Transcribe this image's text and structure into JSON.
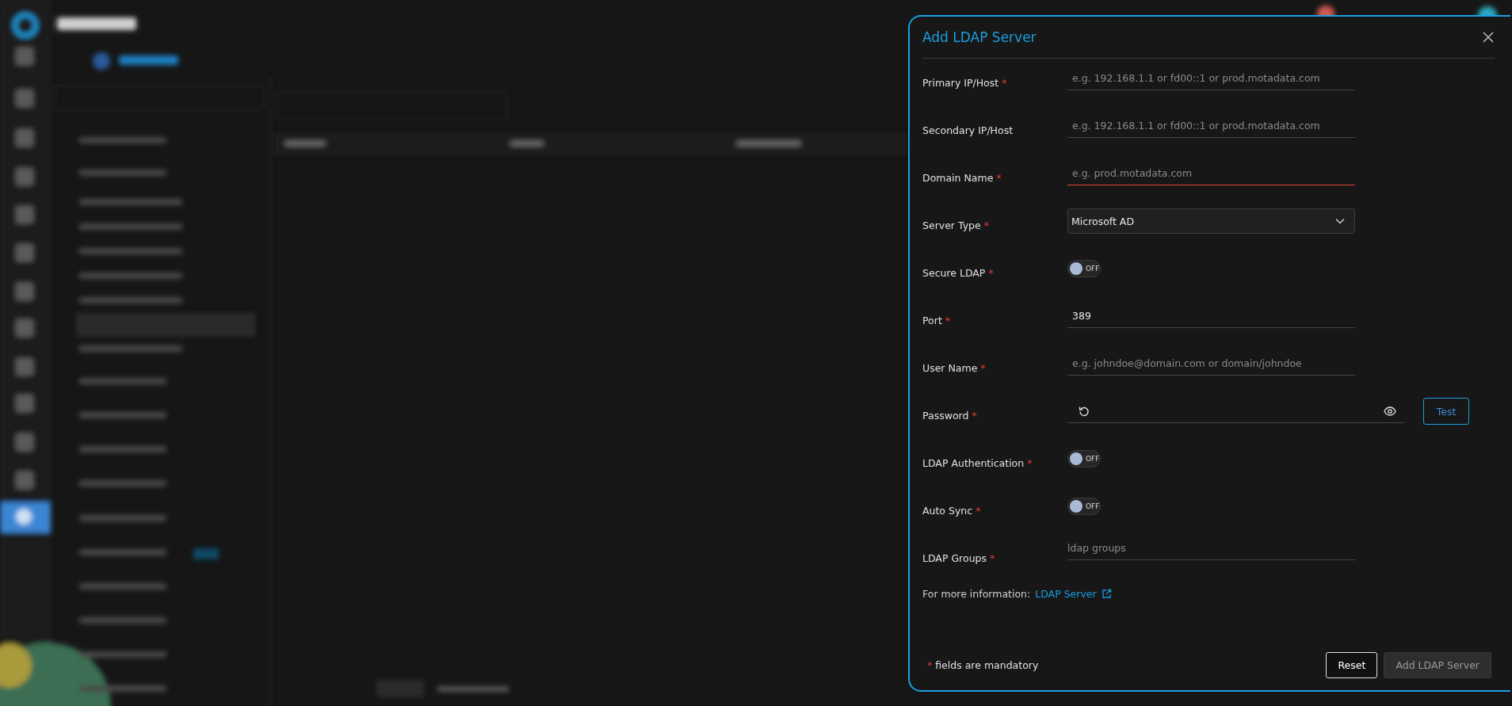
{
  "dialog": {
    "title": "Add LDAP Server",
    "required_mark": "*",
    "fields": [
      {
        "kind": "text",
        "label": "Primary IP/Host",
        "required": true,
        "placeholder": "e.g. 192.168.1.1 or fd00::1 or prod.motadata.com",
        "invalid": false
      },
      {
        "kind": "text",
        "label": "Secondary IP/Host",
        "required": false,
        "placeholder": "e.g. 192.168.1.1 or fd00::1 or prod.motadata.com",
        "invalid": false
      },
      {
        "kind": "text",
        "label": "Domain Name",
        "required": true,
        "placeholder": "e.g. prod.motadata.com",
        "invalid": true
      },
      {
        "kind": "select",
        "label": "Server Type",
        "required": true,
        "value": "Microsoft AD"
      },
      {
        "kind": "toggle",
        "label": "Secure LDAP",
        "required": true,
        "on": false,
        "state_label": "OFF"
      },
      {
        "kind": "text",
        "label": "Port",
        "required": true,
        "value": "389",
        "invalid": false
      },
      {
        "kind": "text",
        "label": "User Name",
        "required": true,
        "placeholder": "e.g. johndoe@domain.com or domain/johndoe",
        "invalid": false
      },
      {
        "kind": "password",
        "label": "Password",
        "required": true,
        "button": "Test"
      },
      {
        "kind": "toggle",
        "label": "LDAP Authentication",
        "required": true,
        "on": false,
        "state_label": "OFF"
      },
      {
        "kind": "toggle",
        "label": "Auto Sync",
        "required": true,
        "on": false,
        "state_label": "OFF"
      },
      {
        "kind": "tags",
        "label": "LDAP Groups",
        "required": true,
        "placeholder": "ldap groups"
      }
    ],
    "info": {
      "prefix": "For more information:",
      "link": "LDAP Server"
    },
    "note": {
      "mark": "*",
      "text": "fields are mandatory"
    },
    "buttons": [
      {
        "label": "Reset",
        "kind": "secondary",
        "disabled": false
      },
      {
        "label": "Add LDAP Server",
        "kind": "primary",
        "disabled": true
      }
    ]
  }
}
